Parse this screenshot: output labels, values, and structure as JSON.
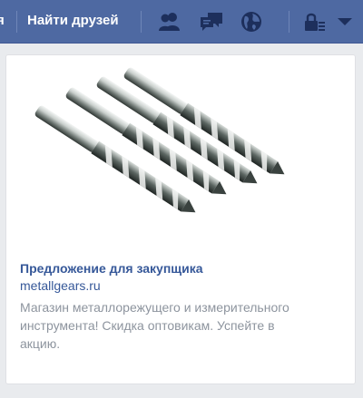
{
  "topbar": {
    "cut_link": "я",
    "find_friends": "Найти друзей"
  },
  "icons": [
    "friend-requests-icon",
    "messages-icon",
    "notifications-globe-icon",
    "privacy-lock-icon",
    "account-menu-caret-icon"
  ],
  "colors": {
    "topbar_bg": "#4e69a2",
    "link": "#365899",
    "muted_text": "#8d949e",
    "page_bg": "#e9ebee"
  },
  "ad": {
    "title": "Предложение для закупщика",
    "domain": "metallgears.ru",
    "description": "Магазин металлорежущего и измерительного инструмента! Скидка оптовикам. Успейте в акцию.",
    "image": "drill-bits-image"
  }
}
